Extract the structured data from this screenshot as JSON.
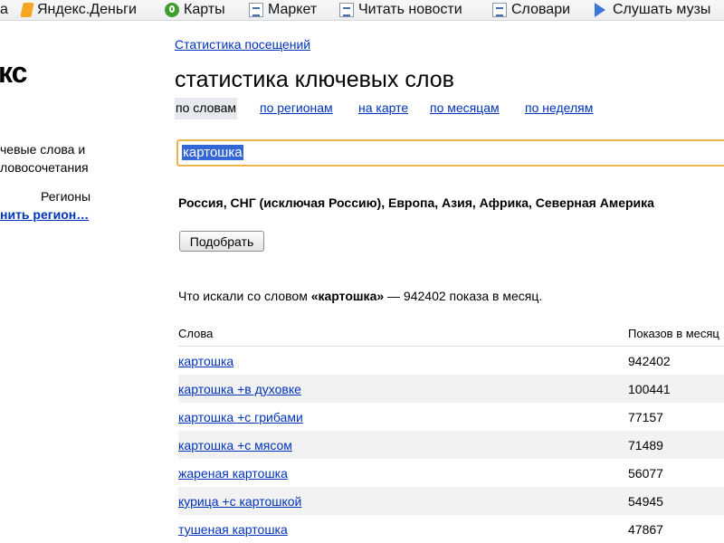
{
  "bookmarks": [
    {
      "label": "а",
      "icon": "none"
    },
    {
      "label": "Яндекс.Деньги",
      "icon": "yandex-money-icon"
    },
    {
      "label": "Карты",
      "icon": "maps-icon"
    },
    {
      "label": "Маркет",
      "icon": "page-icon"
    },
    {
      "label": "Читать новости",
      "icon": "page-icon"
    },
    {
      "label": "Словари",
      "icon": "page-icon"
    },
    {
      "label": "Слушать музы",
      "icon": "play-icon"
    }
  ],
  "left": {
    "logo_fragment": "кс",
    "keywords_line1": "чевые слова и",
    "keywords_line2": "ловосочетания",
    "regions_label": "Регионы",
    "choose_region": "нить регион…"
  },
  "header": {
    "stats_link": "Статистика посещений",
    "title": "статистика ключевых слов"
  },
  "tabs": [
    {
      "label": "по словам",
      "active": true
    },
    {
      "label": "по регионам",
      "active": false
    },
    {
      "label": "на карте",
      "active": false
    },
    {
      "label": "по месяцам",
      "active": false
    },
    {
      "label": "по неделям",
      "active": false
    }
  ],
  "search": {
    "value": "картошка"
  },
  "regions_text": "Россия, СНГ (исключая Россию), Европа, Азия, Африка, Северная Америка",
  "pick_button": "Подобрать",
  "summary": {
    "prefix": "Что искали со словом ",
    "query": "«картошка»",
    "suffix": " — 942402 показа в месяц."
  },
  "table": {
    "headers": {
      "words": "Слова",
      "impressions": "Показов в месяц"
    },
    "rows": [
      {
        "word": "картошка",
        "count": "942402"
      },
      {
        "word": "картошка +в духовке",
        "count": "100441"
      },
      {
        "word": "картошка +с грибами",
        "count": "77157"
      },
      {
        "word": "картошка +с мясом",
        "count": "71489"
      },
      {
        "word": "жареная картошка",
        "count": "56077"
      },
      {
        "word": "курица +с картошкой",
        "count": "54945"
      },
      {
        "word": "тушеная картошка",
        "count": "47867"
      }
    ]
  },
  "colors": {
    "link": "#0033bb",
    "input_border": "#efb54a",
    "selection": "#3367d6"
  }
}
